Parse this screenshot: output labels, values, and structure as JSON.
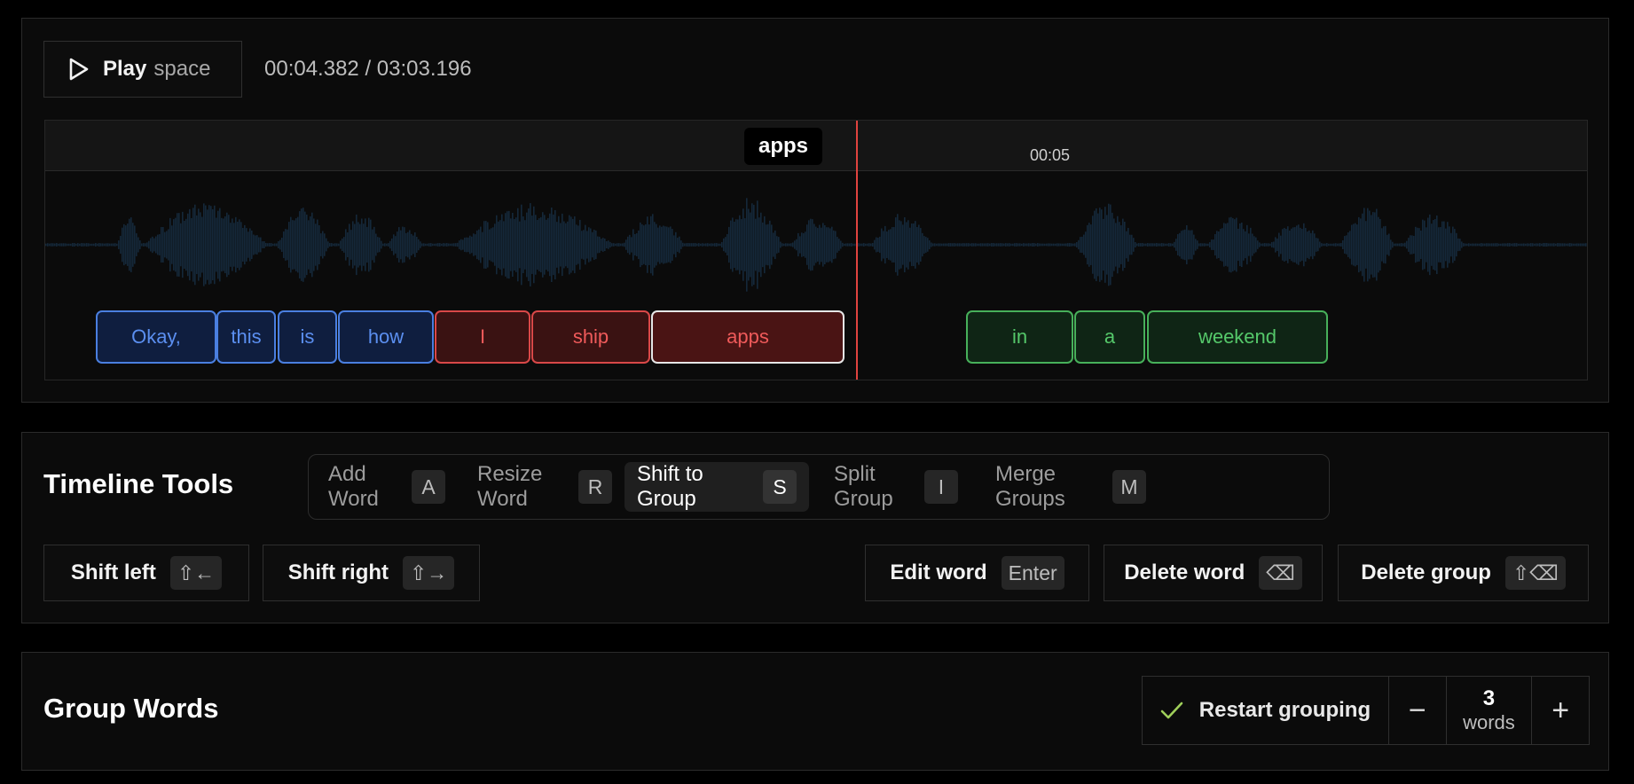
{
  "player": {
    "play_label": "Play",
    "play_hint": "space",
    "time": "00:04.382 / 03:03.196",
    "ruler_tick": "00:05",
    "cursor_word": "apps"
  },
  "words": [
    {
      "text": "Okay,",
      "group": "blue"
    },
    {
      "text": "this",
      "group": "blue"
    },
    {
      "text": "is",
      "group": "blue"
    },
    {
      "text": "how",
      "group": "blue"
    },
    {
      "text": "I",
      "group": "red"
    },
    {
      "text": "ship",
      "group": "red"
    },
    {
      "text": "apps",
      "group": "red",
      "selected": true
    },
    {
      "text": "in",
      "group": "green"
    },
    {
      "text": "a",
      "group": "green"
    },
    {
      "text": "weekend",
      "group": "green"
    }
  ],
  "tools": {
    "title": "Timeline Tools",
    "modes": [
      {
        "label": "Add Word",
        "key": "A"
      },
      {
        "label": "Resize Word",
        "key": "R"
      },
      {
        "label": "Shift to Group",
        "key": "S",
        "active": true
      },
      {
        "label": "Split Group",
        "key": "I"
      },
      {
        "label": "Merge Groups",
        "key": "M"
      }
    ],
    "shift_left": {
      "label": "Shift left",
      "key": "⇧←"
    },
    "shift_right": {
      "label": "Shift right",
      "key": "⇧→"
    },
    "edit_word": {
      "label": "Edit word",
      "key": "Enter"
    },
    "delete_word": {
      "label": "Delete word",
      "key": "⌫"
    },
    "delete_group": {
      "label": "Delete group",
      "key": "⇧⌫"
    }
  },
  "group_words": {
    "title": "Group Words",
    "restart_label": "Restart grouping",
    "count": "3",
    "count_unit": "words",
    "minus": "−",
    "plus": "+"
  },
  "colors": {
    "blue_group": "#4a7fe0",
    "red_group": "#d94848",
    "green_group": "#47b05a",
    "playhead": "#e0433f",
    "waveform": "#15283a"
  }
}
